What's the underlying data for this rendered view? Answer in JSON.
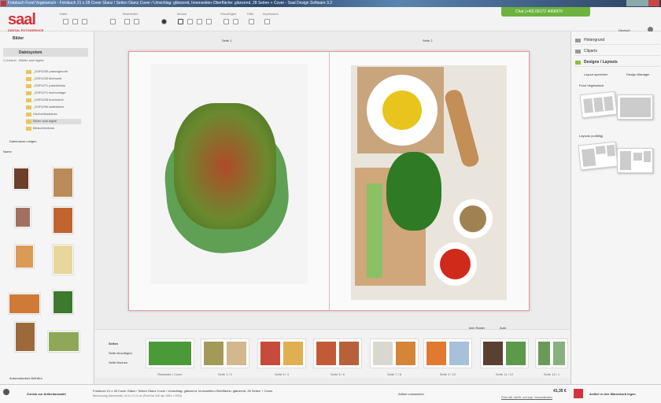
{
  "window": {
    "title": "Fotobuch Food Vegetarisch - Fotobuch 21 x 28 Cover Glanz / Seiten Glanz Cover / Umschlag: glänzend, Innenseiten-Oberfläche: glänzend, 28 Seiten + Cover - Saal Design Software 3.2"
  },
  "brand": {
    "logo": "saal",
    "subtitle": "DIGITAL FOTOSERVICE",
    "color": "#d3333c"
  },
  "toolbar": {
    "groups": [
      "Datei",
      "Bearbeiten",
      "Modus",
      "Hinzufügen",
      "Hilfe",
      "Impressum"
    ],
    "chat": "Chat  (+49) 09172 4068970",
    "language": "Deutsch"
  },
  "left": {
    "panel_title": "Bilder",
    "section": "Dateisystem",
    "path": "C:\\Users\\...\\Bilder saal digital",
    "folders": [
      "_DSF4230 passingmontl",
      "_DSF4235 titelmontl",
      "_DSF4271 passforblau",
      "_DSF4271 tischvorlage",
      "_DSF4238 kochmontl",
      "_DSF4290 kaffeetisch",
      "Hochzeitsstrauss",
      "Bilder saal digital",
      "Bildschirmfotos"
    ],
    "show_names": "Dateinamen zeigen",
    "sort": "Name",
    "auto_fill": "Automatisches Befüllen"
  },
  "pages": {
    "left_label": "Seite 1",
    "right_label": "Seite 2"
  },
  "filmstrip": {
    "title": "Seiten",
    "add": "Seite hinzufügen",
    "delete": "Seite löschen",
    "grid": "kein Raster",
    "zoom": "Auto",
    "labels": [
      "Rückseite / Cover",
      "Seite 1 / 2",
      "Seite 3 / 4",
      "Seite 5 / 6",
      "Seite 7 / 8",
      "Seite 9 / 10",
      "Seite 11 / 12",
      "Seite 13 / 1"
    ]
  },
  "right": {
    "items": [
      "Hintergrund",
      "Cliparts",
      "Designs / Layouts"
    ],
    "save_layout": "Layout speichern",
    "design_manager": "Design-Manager",
    "section1": "Food Vegetarisch",
    "section2": "Layouts (zufällig)"
  },
  "status": {
    "back": "Zurück zur Artikelauswahl",
    "product": "Fotobuch 21 x 28 Cover Glanz / Seiten Glanz Cover / Umschlag: glänzend, Innenseiten-Oberfläche: glänzend, 28 Seiten + Cover",
    "size": "Bemessung (Innenseite): 42,0 x 27,9 cm (Pixel bei 300 dpi: 4961 x 3300)",
    "change": "Artikel umwandeln",
    "price": "41,35 €",
    "price_note": "Preis inkl. MwSt. und zzgl. Versandkosten",
    "cart": "Artikel in den Warenkorb legen"
  }
}
